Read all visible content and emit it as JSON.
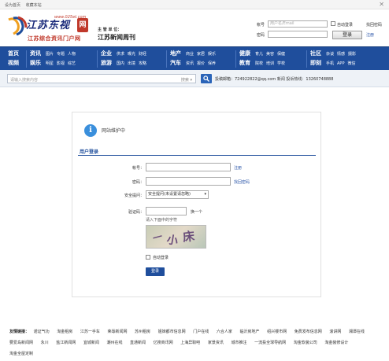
{
  "topbar": {
    "links": [
      "设为首页",
      "收藏本站"
    ],
    "close": "✕"
  },
  "logo": {
    "brand": "江苏东视",
    "url": "www.025et.com",
    "seal": "网",
    "tagline": "江苏综合资讯门户网"
  },
  "sponsor": {
    "line1": "主 管 单 位：",
    "line2": "江苏新闻周刊"
  },
  "login": {
    "account_label": "帐号",
    "account_placeholder": "用户名/Email",
    "auto_login": "自动登录",
    "forget": "找回密码",
    "password_label": "密码",
    "login_button": "登录",
    "register": "注册"
  },
  "nav": {
    "groups": [
      {
        "main": [
          "首页",
          "视频"
        ],
        "subs": [
          [],
          []
        ]
      },
      {
        "main": [
          "资讯",
          "娱乐"
        ],
        "subs": [
          [
            "图片",
            "专题",
            "人物"
          ],
          [
            "明星",
            "影视",
            "综艺"
          ]
        ]
      },
      {
        "main": [
          "企业",
          "旅游"
        ],
        "subs": [
          [
            "供求",
            "曝光",
            "财经"
          ],
          [
            "国内",
            "出境",
            "攻略"
          ]
        ]
      },
      {
        "main": [
          "地产",
          "汽车"
        ],
        "subs": [
          [
            "商业",
            "家居",
            "娱乐"
          ],
          [
            "资讯",
            "报价",
            "保养"
          ]
        ]
      },
      {
        "main": [
          "健康",
          "教育"
        ],
        "subs": [
          [
            "育儿",
            "美容",
            "保健"
          ],
          [
            "院校",
            "培训",
            "学校"
          ]
        ]
      },
      {
        "main": [
          "社区",
          "即刻"
        ],
        "subs": [
          [
            "杂谈",
            "情感",
            "摄影"
          ],
          [
            "手机",
            "APP",
            "微信"
          ]
        ]
      }
    ]
  },
  "search": {
    "placeholder": "请输入搜索内容",
    "category": "搜索 ▾",
    "contact": "投稿邮箱：724922822@qq.com 新闻 投诉热线：13260748888"
  },
  "panel": {
    "notice": "网站维护中",
    "section_title": "用户登录",
    "fields": {
      "account": {
        "label": "帐号：",
        "hint": "注册"
      },
      "password": {
        "label": "密码：",
        "hint": "找回密码"
      },
      "question": {
        "label": "安全提问：",
        "value": "安全提问(未设置请忽略)"
      },
      "captcha": {
        "label": "验证码：",
        "change": "换一个"
      }
    },
    "captcha_note": "请入下面中的字符",
    "captcha_chars": [
      "一",
      "小",
      "床"
    ],
    "auto_login": "自动登录",
    "submit": "登录"
  },
  "friends": {
    "title": "友情链接：",
    "links": [
      "诺证气功",
      "淘金租房",
      "江苏一手车",
      "荣辱新闻网",
      "苏州租房",
      "姐妹都市信息网",
      "门户在线",
      "六合人家",
      "临沂房地产",
      "绍兴楼市网",
      "免费发布信息网",
      "滚讲网",
      "湘潭在线",
      "要爱岛新闻网",
      "永川",
      "盐江新闻网",
      "宜城新闻",
      "潮州在线",
      "直通新闻",
      "亿搜商讯网",
      "上海异职吧",
      "家景资讯",
      "城市推注",
      "一流投全球导航网",
      "淘金软装公司",
      "淘金装修设计",
      "淘金全屋定制"
    ]
  },
  "colors": {
    "nav": "#1f4e9c",
    "accent": "#c0392b",
    "link": "#2a55a8"
  }
}
